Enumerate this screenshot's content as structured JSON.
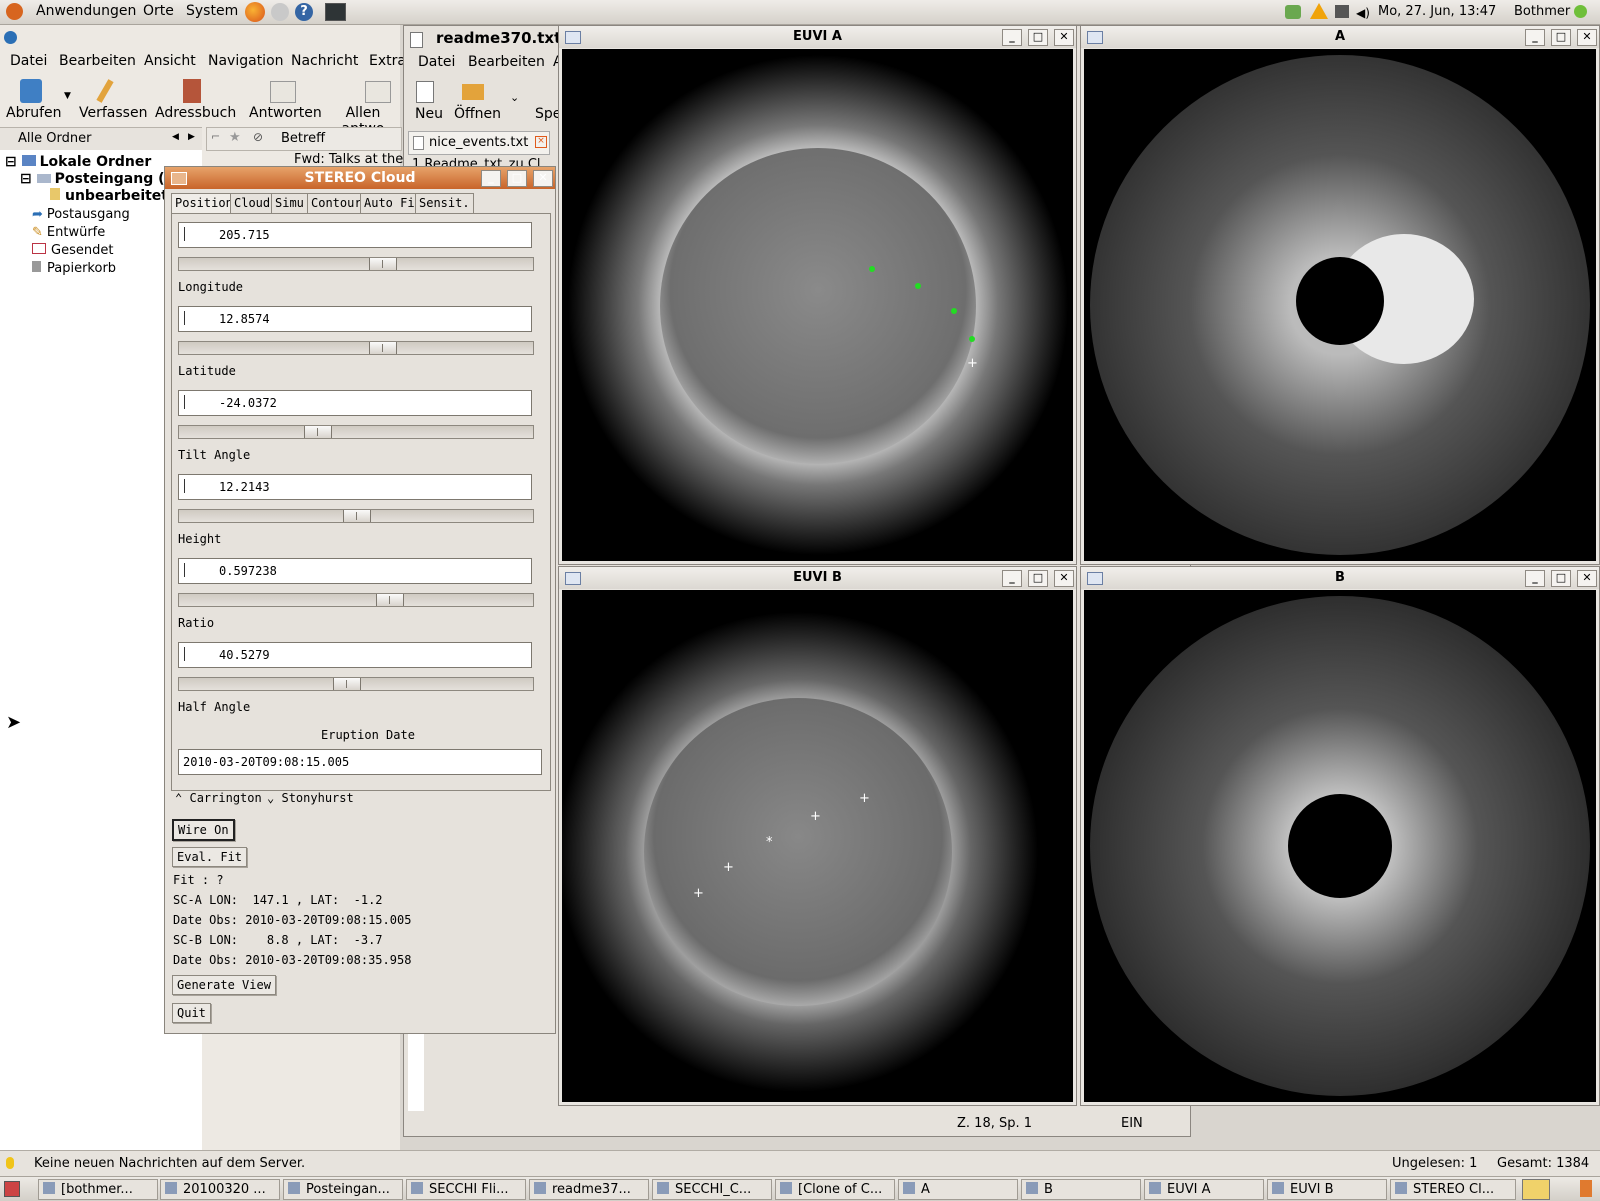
{
  "top_panel": {
    "menu_apps": "Anwendungen",
    "menu_places": "Orte",
    "menu_system": "System",
    "clock": "Mo, 27. Jun, 13:47",
    "user": "Bothmer"
  },
  "thunderbird": {
    "menu": [
      "Datei",
      "Bearbeiten",
      "Ansicht",
      "Navigation",
      "Nachricht",
      "Extra"
    ],
    "toolbar": {
      "fetch": "Abrufen",
      "compose": "Verfassen",
      "addressbook": "Adressbuch",
      "reply": "Antworten",
      "reply_all": "Allen antwo"
    },
    "folder_header": "Alle Ordner",
    "col_subject": "Betreff",
    "message_subject": "Fwd: Talks at the",
    "folders": {
      "local": "Lokale Ordner",
      "inbox": "Posteingang (1",
      "unprocessed": "unbearbeitet",
      "outbox": "Postausgang",
      "drafts": "Entwürfe",
      "sent": "Gesendet",
      "trash": "Papierkorb"
    },
    "status": "Keine neuen Nachrichten auf dem Server.",
    "unread": "Ungelesen: 1",
    "total": "Gesamt: 1384"
  },
  "editor": {
    "title": "readme370.txt (",
    "menu": [
      "Datei",
      "Bearbeiten",
      "A"
    ],
    "toolbar": {
      "new": "Neu",
      "open": "Öffnen",
      "save": "Spe"
    },
    "tab": "nice_events.txt",
    "line1": "1 Readme_txt_zu Cl",
    "status_pos": "Z. 18, Sp. 1",
    "status_mode": "EIN"
  },
  "windows": {
    "euvi_a": "EUVI A",
    "cor_a": "A",
    "euvi_b": "EUVI B",
    "cor_b": "B"
  },
  "cloud": {
    "title": "STEREO Cloud",
    "tabs": [
      "Position",
      "Cloud",
      "Simu",
      "Contour",
      "Auto Fit",
      "Sensit."
    ],
    "params": [
      {
        "label": "Longitude",
        "value": "205.715",
        "slider_fraction": 0.58
      },
      {
        "label": "Latitude",
        "value": "12.8574",
        "slider_fraction": 0.58
      },
      {
        "label": "Tilt Angle",
        "value": "-24.0372",
        "slider_fraction": 0.38
      },
      {
        "label": "Height",
        "value": "12.2143",
        "slider_fraction": 0.5
      },
      {
        "label": "Ratio",
        "value": "0.597238",
        "slider_fraction": 0.6
      },
      {
        "label": "Half Angle",
        "value": "40.5279",
        "slider_fraction": 0.47
      }
    ],
    "eruption_label": "Eruption Date",
    "eruption_date": "2010-03-20T09:08:15.005",
    "radio_carrington": "Carrington",
    "radio_stonyhurst": "Stonyhurst",
    "wire_btn": "Wire On",
    "eval_btn": "Eval. Fit",
    "fit_text": "Fit : ?",
    "sca_line": "SC-A LON:  147.1 , LAT:  -1.2",
    "sca_date": "Date Obs: 2010-03-20T09:08:15.005",
    "scb_line": "SC-B LON:    8.8 , LAT:  -3.7",
    "scb_date": "Date Obs: 2010-03-20T09:08:35.958",
    "generate_btn": "Generate View",
    "quit_btn": "Quit"
  },
  "taskbar": [
    "[bothmer...",
    "20100320 ...",
    "Posteingan...",
    "SECCHI Fli...",
    "readme37...",
    "SECCHI_C...",
    "[Clone of C...",
    "A",
    "B",
    "EUVI A",
    "EUVI B",
    "STEREO Cl..."
  ]
}
